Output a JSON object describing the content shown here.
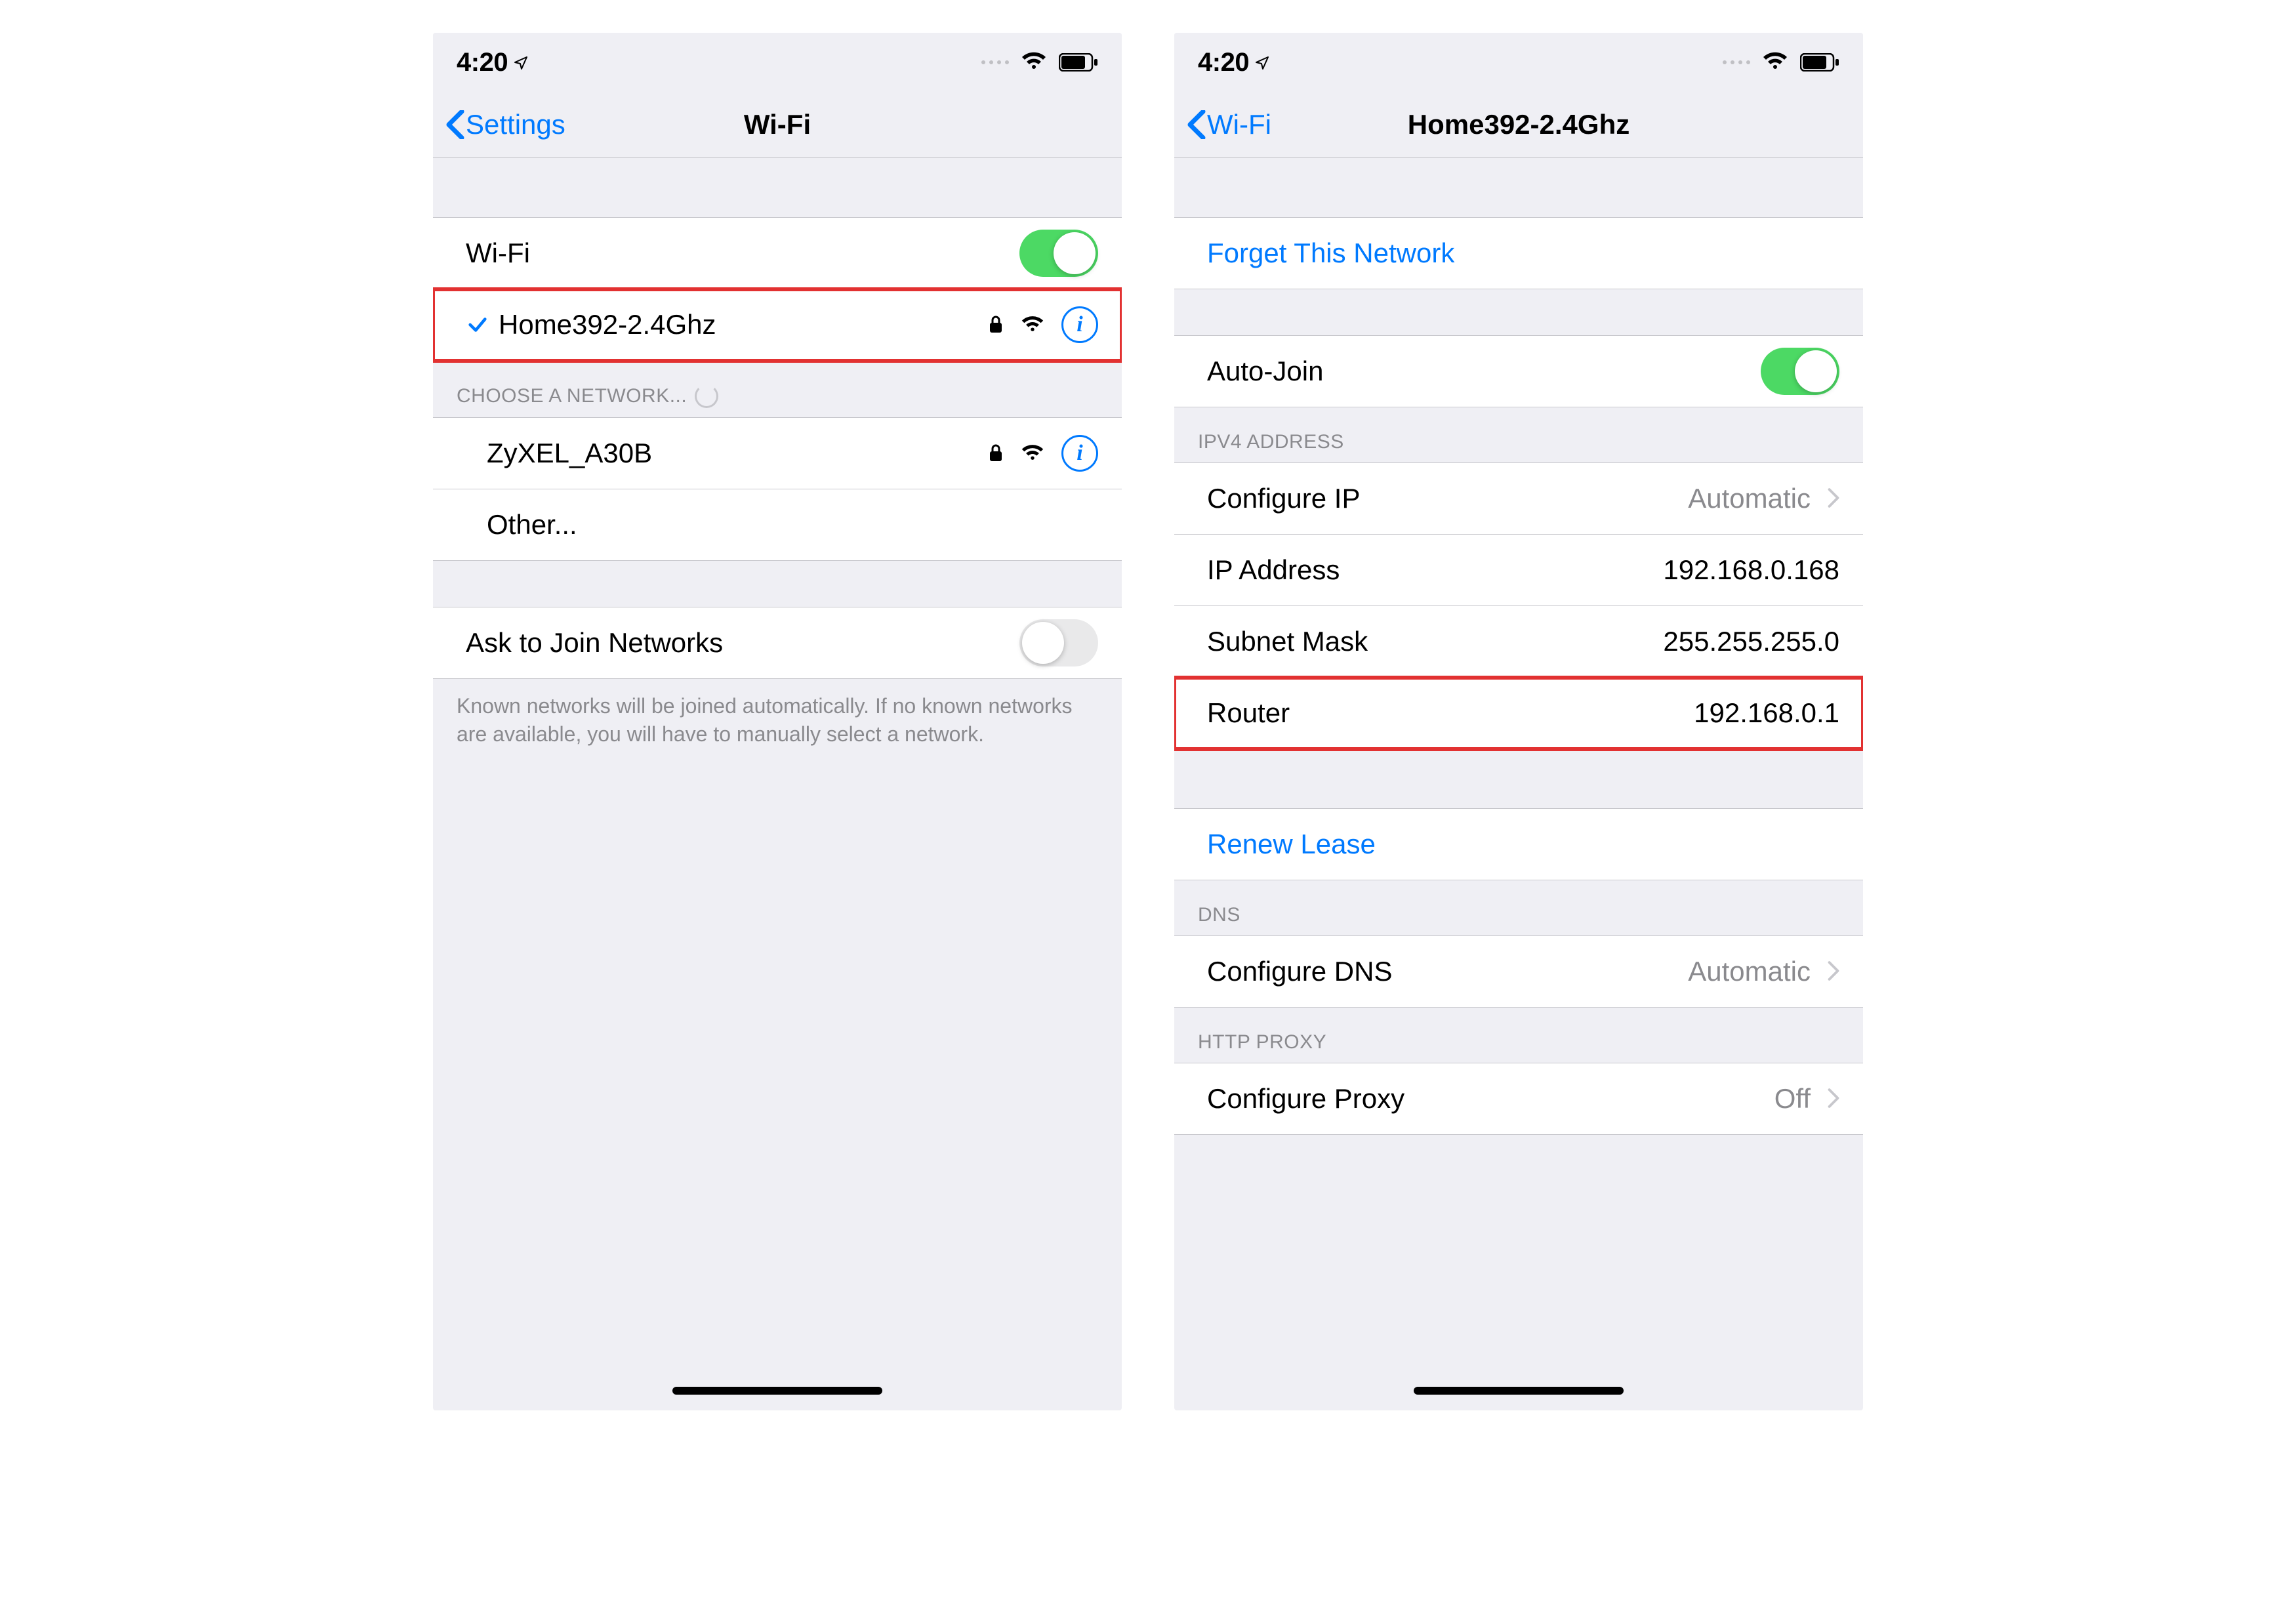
{
  "status": {
    "time": "4:20"
  },
  "screen_left": {
    "back_label": "Settings",
    "title": "Wi-Fi",
    "wifi_row_label": "Wi-Fi",
    "connected_ssid": "Home392-2.4Ghz",
    "choose_header": "CHOOSE A NETWORK...",
    "other_networks": [
      "ZyXEL_A30B"
    ],
    "other_label": "Other...",
    "ask_label": "Ask to Join Networks",
    "ask_footer": "Known networks will be joined automatically. If no known networks are available, you will have to manually select a network.",
    "wifi_on": true,
    "ask_on": false
  },
  "screen_right": {
    "back_label": "Wi-Fi",
    "title": "Home392-2.4Ghz",
    "forget_label": "Forget This Network",
    "autojoin_label": "Auto-Join",
    "autojoin_on": true,
    "ipv4_header": "IPV4 ADDRESS",
    "rows": {
      "configure_ip_label": "Configure IP",
      "configure_ip_value": "Automatic",
      "ip_label": "IP Address",
      "ip_value": "192.168.0.168",
      "subnet_label": "Subnet Mask",
      "subnet_value": "255.255.255.0",
      "router_label": "Router",
      "router_value": "192.168.0.1"
    },
    "renew_label": "Renew Lease",
    "dns_header": "DNS",
    "dns_label": "Configure DNS",
    "dns_value": "Automatic",
    "proxy_header": "HTTP PROXY",
    "proxy_label": "Configure Proxy",
    "proxy_value": "Off"
  }
}
